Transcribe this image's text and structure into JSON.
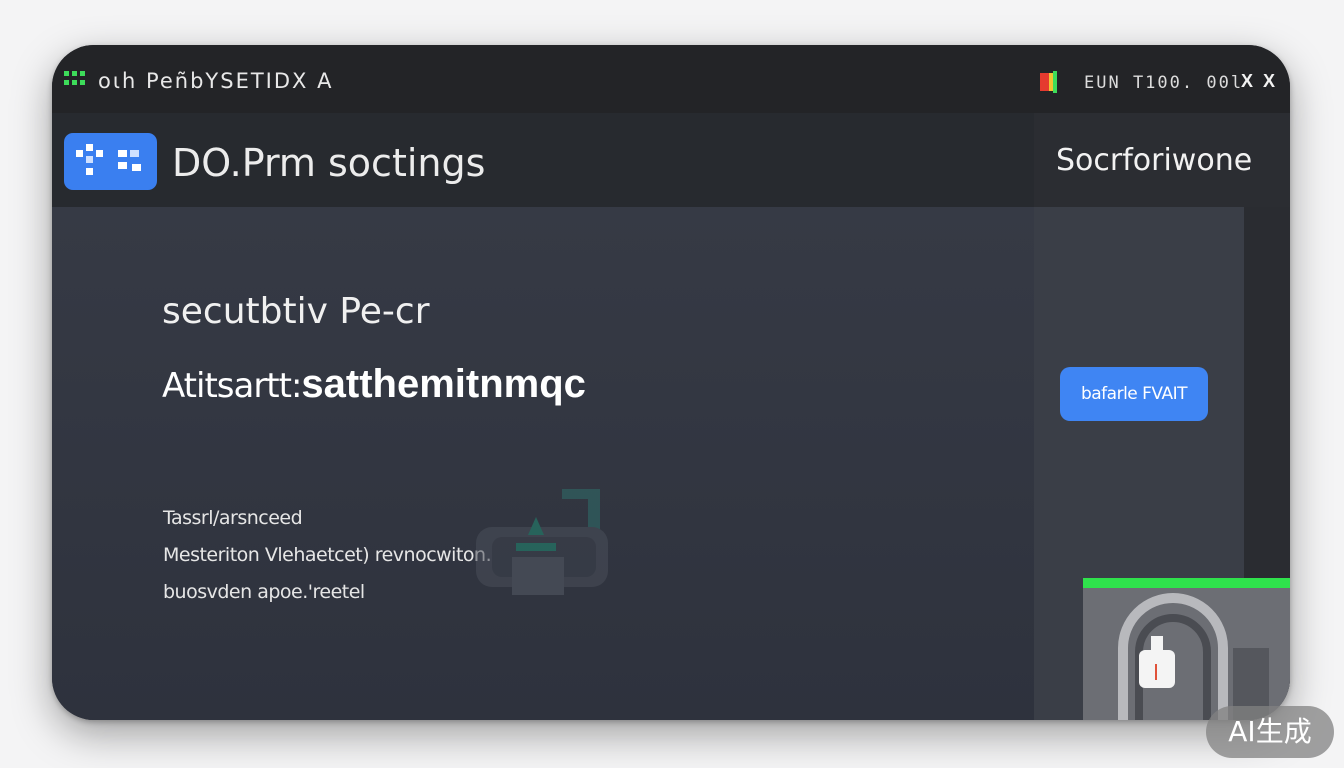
{
  "titlebar": {
    "title": "oιh PeñbYSETIDX A",
    "status": "EUN T100. 00l",
    "close_label": "X",
    "maximize_label": "X"
  },
  "header": {
    "app_name": "DO.Prm soctings"
  },
  "main": {
    "section_title": "secutbtiv Pe-cr",
    "auth_label": "Atitsartt:",
    "auth_value": "satthemitnmqc",
    "description": [
      "Tassrl/arsnceed",
      "Mesteriton Vlehaetcet) revnocwiton.",
      "buosvden apoe.'reetel"
    ]
  },
  "sidebar": {
    "title": "Socrforiwone",
    "button_label": "bafarle FVAIT"
  },
  "watermark": "AI生成",
  "colors": {
    "accent": "#3f85f3",
    "status_green": "#2fe24c",
    "background": "#2f333d"
  },
  "icons": [
    "grid-icon",
    "flag-icon",
    "close-icon",
    "lock-icon"
  ]
}
